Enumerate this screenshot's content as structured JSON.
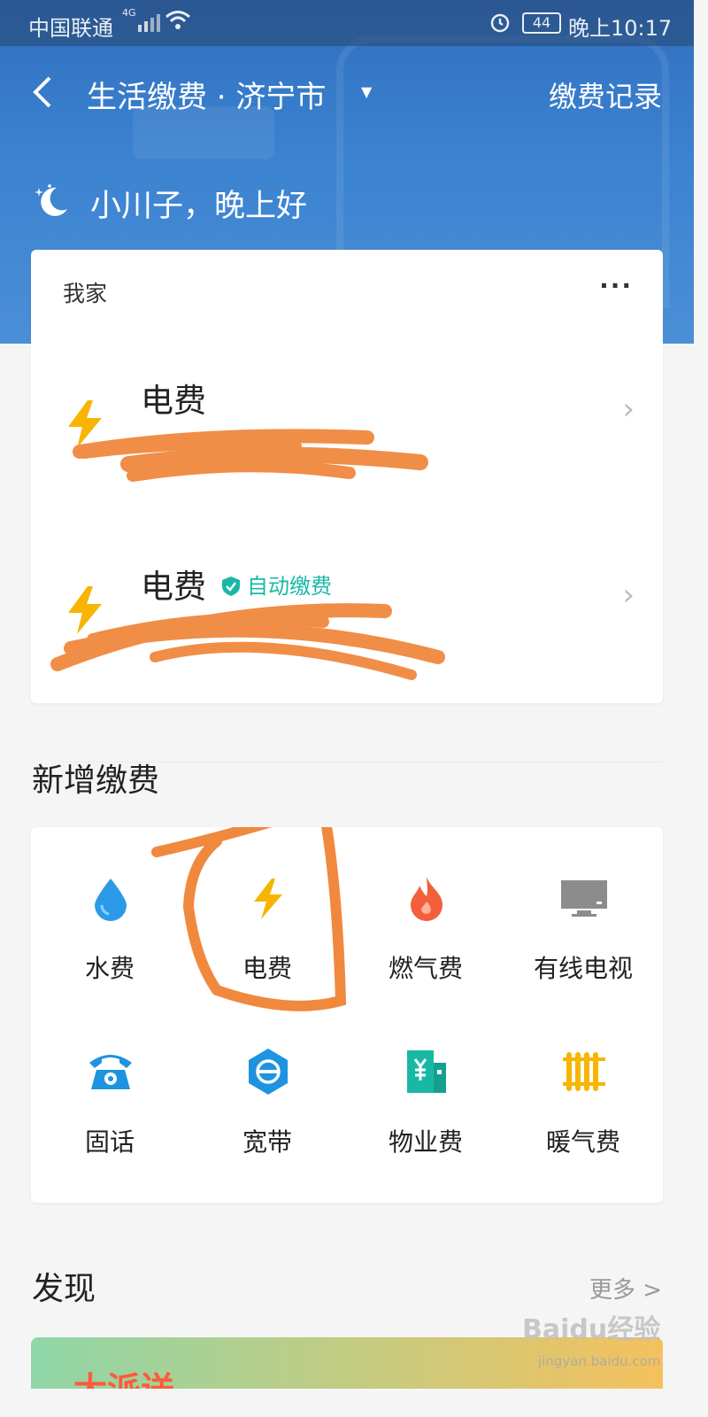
{
  "status_bar": {
    "carrier": "中国联通",
    "network": "4G",
    "battery": "44",
    "time": "晚上10:17"
  },
  "navbar": {
    "title": "生活缴费 · 济宁市",
    "record": "缴费记录"
  },
  "greeting": "小川子，晚上好",
  "home_card": {
    "title": "我家",
    "more": "···",
    "items": [
      {
        "name": "电费",
        "badge": ""
      },
      {
        "name": "电费",
        "badge": "自动缴费"
      }
    ]
  },
  "new_payment": {
    "title": "新增缴费",
    "items": [
      {
        "label": "水费",
        "icon": "water-drop-icon",
        "color": "#2b9be8"
      },
      {
        "label": "电费",
        "icon": "lightning-icon",
        "color": "#f7b500"
      },
      {
        "label": "燃气费",
        "icon": "flame-icon",
        "color": "#f25f3a"
      },
      {
        "label": "有线电视",
        "icon": "tv-icon",
        "color": "#8c8c8c"
      },
      {
        "label": "固话",
        "icon": "telephone-icon",
        "color": "#1e93e0"
      },
      {
        "label": "宽带",
        "icon": "broadband-icon",
        "color": "#1e93e0"
      },
      {
        "label": "物业费",
        "icon": "building-icon",
        "color": "#19b8a5"
      },
      {
        "label": "暖气费",
        "icon": "radiator-icon",
        "color": "#f7b500"
      }
    ]
  },
  "discover": {
    "title": "发现",
    "more": "更多 >",
    "banner_text": "大派送"
  },
  "watermark": {
    "brand": "Baidu经验",
    "url": "jingyan.baidu.com"
  },
  "colors": {
    "primary_blue": "#3b82d0",
    "accent_teal": "#19b8a5",
    "annotation_orange": "#f0883e"
  }
}
